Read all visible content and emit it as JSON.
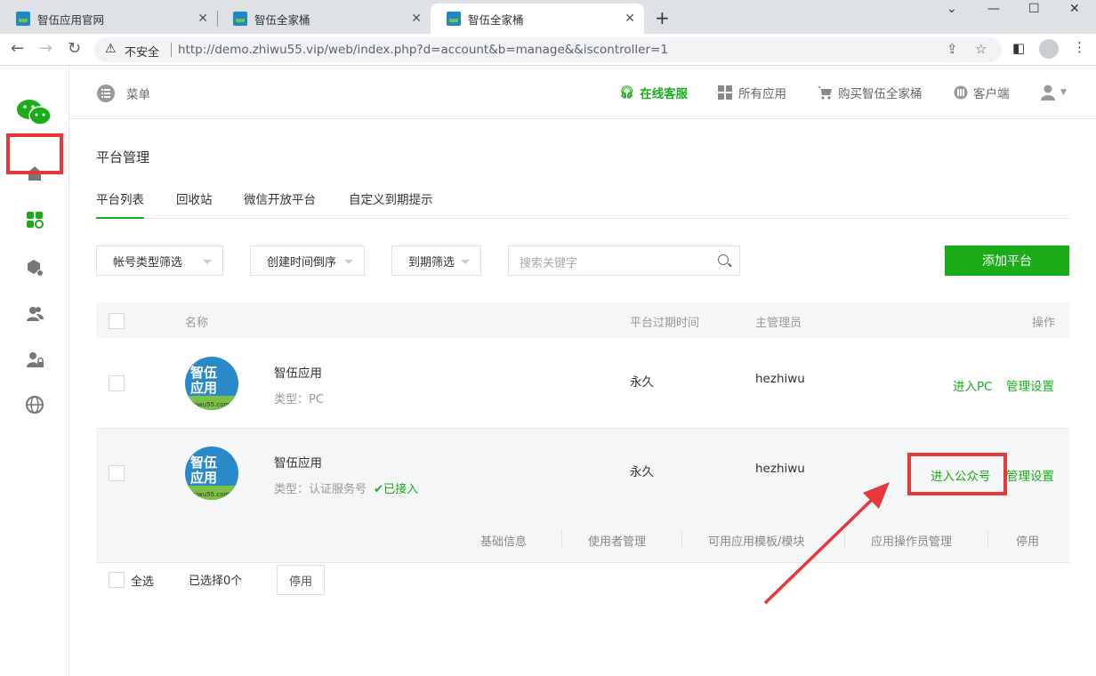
{
  "browser": {
    "tabs": [
      {
        "title": "智伍应用官网"
      },
      {
        "title": "智伍全家桶"
      },
      {
        "title": "智伍全家桶"
      }
    ],
    "insecure_label": "不安全",
    "url": "http://demo.zhiwu55.vip/web/index.php?d=account&b=manage&&iscontroller=1"
  },
  "header": {
    "menu": "菜单",
    "online_service": "在线客服",
    "all_apps": "所有应用",
    "buy": "购买智伍全家桶",
    "client": "客户端"
  },
  "page": {
    "title": "平台管理",
    "subtabs": [
      "平台列表",
      "回收站",
      "微信开放平台",
      "自定义到期提示"
    ]
  },
  "filters": {
    "account_type": "帐号类型筛选",
    "created_sort": "创建时间倒序",
    "expiry": "到期筛选",
    "search_placeholder": "搜索关键字",
    "add_button": "添加平台"
  },
  "table": {
    "headers": {
      "name": "名称",
      "expiry": "平台过期时间",
      "admin": "主管理员",
      "ops": "操作"
    },
    "rows": [
      {
        "name": "智伍应用",
        "type": "类型：PC",
        "status": "",
        "expiry": "永久",
        "admin": "hezhiwu",
        "enter": "进入PC",
        "manage": "管理设置"
      },
      {
        "name": "智伍应用",
        "type": "类型：认证服务号",
        "status": "已接入",
        "expiry": "永久",
        "admin": "hezhiwu",
        "enter": "进入公众号",
        "manage": "管理设置"
      }
    ],
    "row_submenu": [
      "基础信息",
      "使用者管理",
      "可用应用模板/模块",
      "应用操作员管理",
      "停用"
    ]
  },
  "footer": {
    "select_all": "全选",
    "selected": "已选择0个",
    "stop": "停用"
  },
  "logo_text": {
    "line1": "智伍",
    "line2": "应用",
    "site": "zhiwu55.com"
  },
  "colors": {
    "accent": "#1aad19",
    "highlight": "#e5383b"
  }
}
